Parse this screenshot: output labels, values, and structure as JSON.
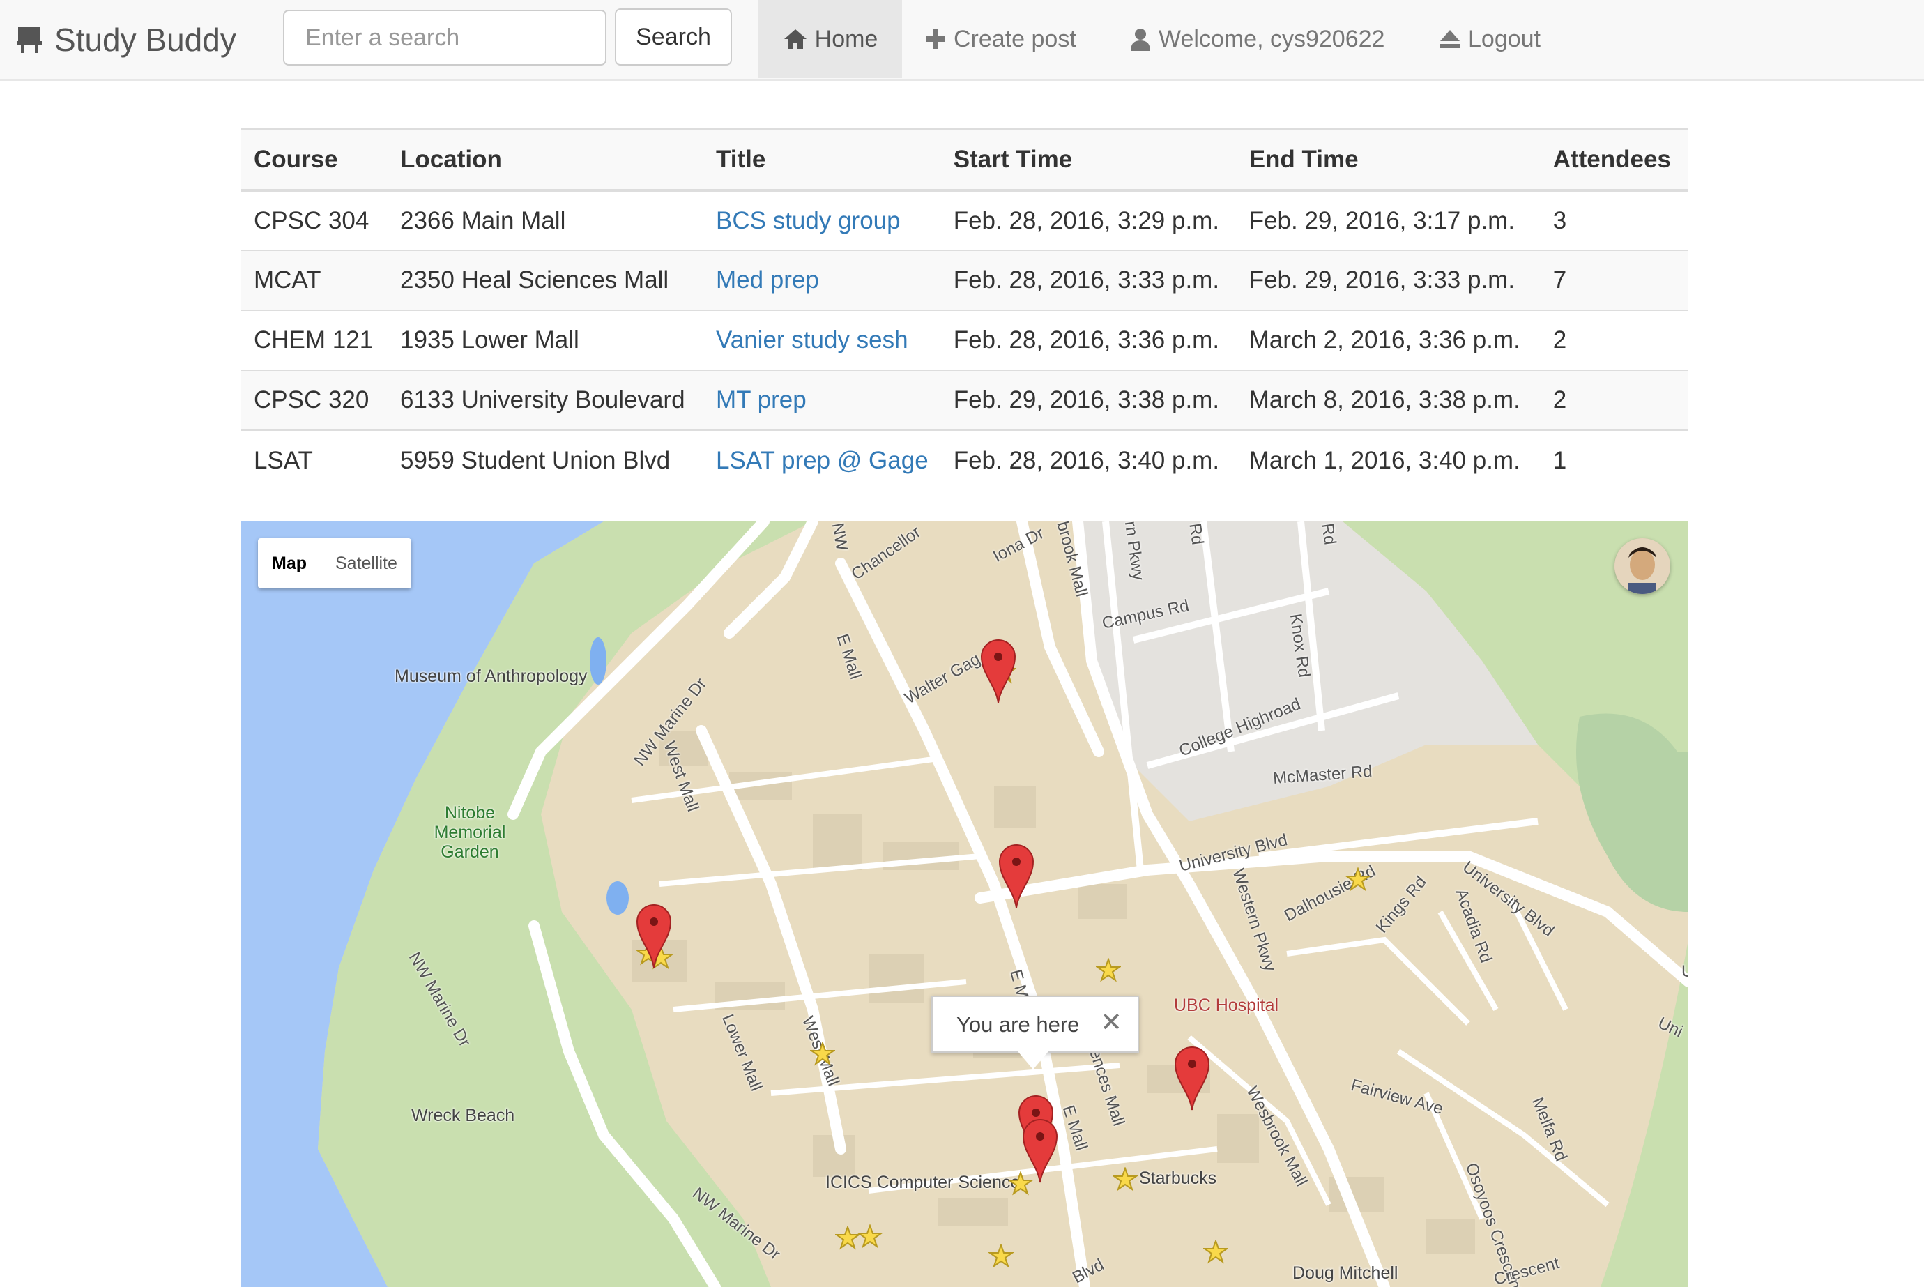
{
  "navbar": {
    "brand": "Study Buddy",
    "search_placeholder": "Enter a search",
    "search_button": "Search",
    "home": "Home",
    "create_post": "Create post",
    "welcome": "Welcome, cys920622",
    "logout": "Logout"
  },
  "table": {
    "headers": [
      "Course",
      "Location",
      "Title",
      "Start Time",
      "End Time",
      "Attendees"
    ],
    "rows": [
      {
        "course": "CPSC 304",
        "location": "2366 Main Mall",
        "title": "BCS study group",
        "start": "Feb. 28, 2016, 3:29 p.m.",
        "end": "Feb. 29, 2016, 3:17 p.m.",
        "attendees": "3"
      },
      {
        "course": "MCAT",
        "location": "2350 Heal Sciences Mall",
        "title": "Med prep",
        "start": "Feb. 28, 2016, 3:33 p.m.",
        "end": "Feb. 29, 2016, 3:33 p.m.",
        "attendees": "7"
      },
      {
        "course": "CHEM 121",
        "location": "1935 Lower Mall",
        "title": "Vanier study sesh",
        "start": "Feb. 28, 2016, 3:36 p.m.",
        "end": "March 2, 2016, 3:36 p.m.",
        "attendees": "2"
      },
      {
        "course": "CPSC 320",
        "location": "6133 University Boulevard",
        "title": "MT prep",
        "start": "Feb. 29, 2016, 3:38 p.m.",
        "end": "March 8, 2016, 3:38 p.m.",
        "attendees": "2"
      },
      {
        "course": "LSAT",
        "location": "5959 Student Union Blvd",
        "title": "LSAT prep @ Gage",
        "start": "Feb. 28, 2016, 3:40 p.m.",
        "end": "March 1, 2016, 3:40 p.m.",
        "attendees": "1"
      }
    ]
  },
  "map": {
    "type_map": "Map",
    "type_satellite": "Satellite",
    "info_window": "You are here",
    "close_glyph": "✕",
    "labels": {
      "museum": "Museum of Anthropology",
      "nitobe": "Nitobe Memorial Garden",
      "wreck": "Wreck Beach",
      "hospital": "UBC Hospital",
      "icics": "ICICS Computer Science",
      "starbucks": "Starbucks",
      "doug": "Doug Mitchell"
    },
    "roads": {
      "chancellor": "Chancellor",
      "iona": "Iona Dr",
      "wesbrook_top": "brook Mall",
      "pkwy": "rn Pkwy",
      "rd1": "Rd",
      "rd2": "Rd",
      "nw_top": "NW",
      "campus": "Campus Rd",
      "knox": "Knox Rd",
      "walter": "Walter Gag",
      "emall_top": "E Mall",
      "nw_marine": "NW Marine Dr",
      "west_mall": "West Mall",
      "college": "College Highroad",
      "mcmaster": "McMaster Rd",
      "university": "University Blvd",
      "dalhousie": "Dalhousie Rd",
      "kings": "Kings Rd",
      "acadia": "Acadia Rd",
      "university_right": "University Blvd",
      "western": "Western Pkwy",
      "nw_marine_left": "NW Marine Dr",
      "lower_mall": "Lower Mall",
      "west_mall2": "West Mall",
      "em_mid": "E M",
      "sciences": "Sciences Mall",
      "e_mall2": "E Mall",
      "wesbrook": "Wesbrook Mall",
      "fairview": "Fairview Ave",
      "melfa": "Melfa Rd",
      "nw_marine_bottom": "NW Marine Dr",
      "blvd": "Blvd",
      "osoyoos": "Osoyoos Crescent",
      "crescent": "Crescent",
      "uni_edge": "Uni",
      "u_edge": "U"
    },
    "colors": {
      "water": "#a5c7f7",
      "park": "#c9dfaf",
      "campus": "#e8dcc0",
      "road": "#ffffff",
      "pin": "#e43b3b",
      "star": "#f9d94a"
    }
  },
  "icons": [
    "brand-desk-icon",
    "home-icon",
    "plus-icon",
    "user-icon",
    "eject-icon",
    "map-pin-icon",
    "star-icon",
    "close-icon"
  ]
}
